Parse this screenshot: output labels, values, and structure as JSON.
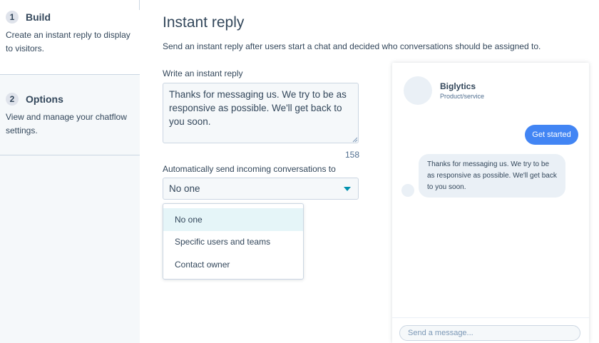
{
  "steps": [
    {
      "number": "1",
      "title": "Build",
      "description": "Create an instant reply to display to visitors."
    },
    {
      "number": "2",
      "title": "Options",
      "description": "View and manage your chatflow settings."
    }
  ],
  "main": {
    "title": "Instant reply",
    "subtitle": "Send an instant reply after users start a chat and decided who conversations should be assigned to.",
    "reply_label": "Write an instant reply",
    "reply_value": "Thanks for messaging us. We try to be as responsive as possible. We'll get back to you soon.",
    "char_count": "158",
    "assign_label": "Automatically send incoming conversations to",
    "assign_selected": "No one",
    "assign_options": [
      "No one",
      "Specific users and teams",
      "Contact owner"
    ]
  },
  "preview": {
    "brand_name": "Biglytics",
    "brand_type": "Product/service",
    "button_label": "Get started",
    "message": "Thanks for messaging us. We try to be as responsive as possible. We'll get back to you soon.",
    "composer_placeholder": "Send a message..."
  },
  "colors": {
    "accent": "#4285f4",
    "caret": "#0091ae",
    "text": "#33475b",
    "highlight": "#e5f5f8",
    "panel_bg": "#f5f8fa"
  }
}
